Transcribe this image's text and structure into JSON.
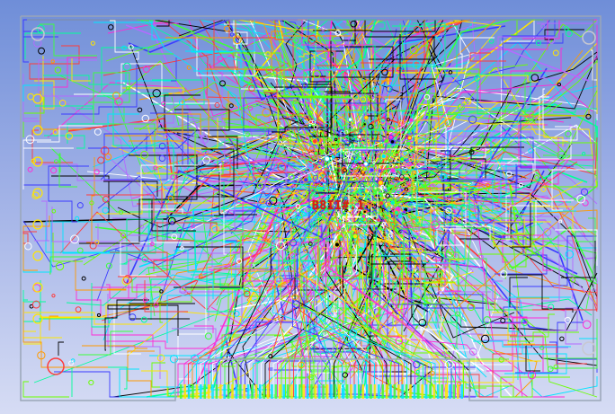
{
  "board": {
    "refdes_label": "B8II#.1",
    "outline_color": "#9aa6b8",
    "background_top": "#6f8ed8",
    "background_bottom": "#d6dcf4",
    "trace_palette": [
      "#ff2bd6",
      "#00e5ff",
      "#3cff3c",
      "#ffe600",
      "#ff3b3b",
      "#3b3bff",
      "#ff9a00",
      "#b36bff",
      "#00ff9a",
      "#ffffff",
      "#000000",
      "#6bff00"
    ]
  }
}
